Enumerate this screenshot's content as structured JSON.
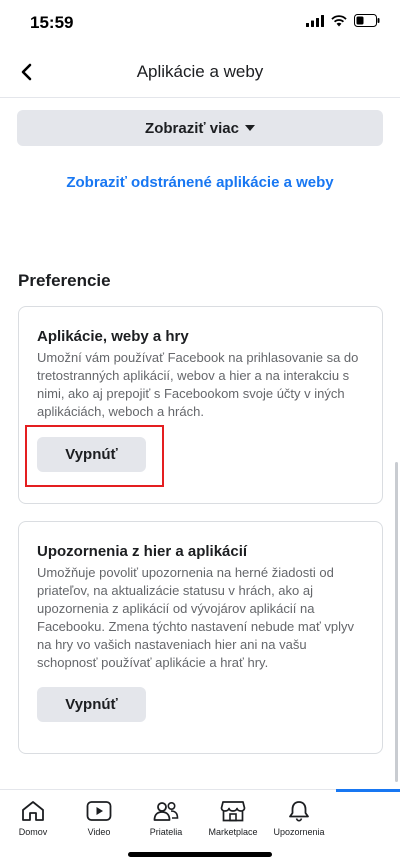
{
  "status": {
    "time": "15:59"
  },
  "nav": {
    "title": "Aplikácie a weby"
  },
  "main": {
    "show_more_label": "Zobraziť viac",
    "removed_link": "Zobraziť odstránené aplikácie a weby",
    "section_title": "Preferencie"
  },
  "cards": [
    {
      "title": "Aplikácie, weby a hry",
      "text": "Umožní vám používať Facebook na prihlasovanie sa do tretostranných aplikácií, webov a hier a na interakciu s nimi, ako aj prepojiť s Facebookom svoje účty v iných aplikáciách, weboch a hrách.",
      "button": "Vypnúť"
    },
    {
      "title": "Upozornenia z hier a aplikácií",
      "text": "Umožňuje povoliť upozornenia na herné žiadosti od priateľov, na aktualizácie statusu v hrách, ako aj upozornenia z aplikácií od vývojárov aplikácií na Facebooku. Zmena týchto nastavení nebude mať vplyv na hry vo vašich nastaveniach hier ani na vašu schopnosť používať aplikácie a hrať hry.",
      "button": "Vypnúť"
    }
  ],
  "tabs": [
    {
      "label": "Domov",
      "icon": "home-icon"
    },
    {
      "label": "Video",
      "icon": "video-icon"
    },
    {
      "label": "Priatelia",
      "icon": "friends-icon"
    },
    {
      "label": "Marketplace",
      "icon": "marketplace-icon"
    },
    {
      "label": "Upozornenia",
      "icon": "bell-icon"
    }
  ],
  "colors": {
    "accent": "#1877f2",
    "highlight": "#e41e20",
    "button_bg": "#e4e6eb"
  }
}
